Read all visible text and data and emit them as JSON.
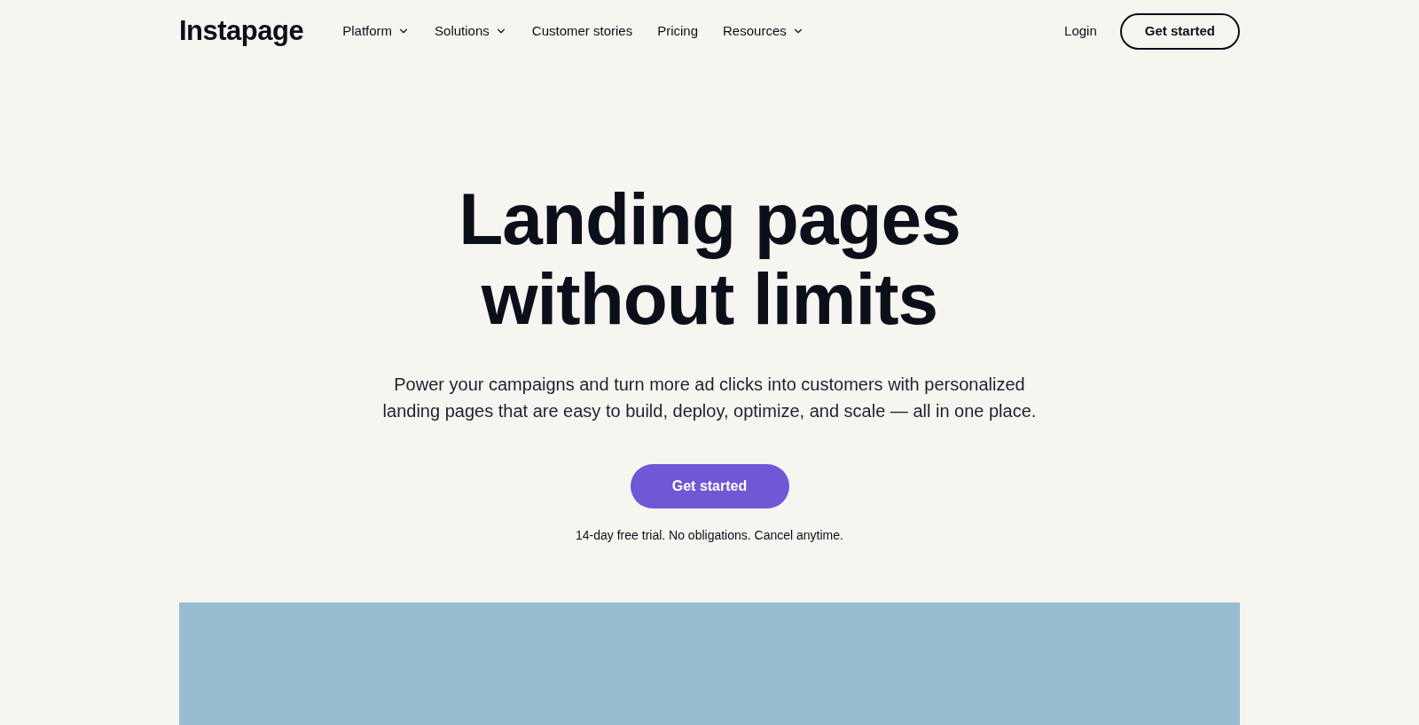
{
  "logo": "Instapage",
  "nav": [
    {
      "label": "Platform",
      "dropdown": true
    },
    {
      "label": "Solutions",
      "dropdown": true
    },
    {
      "label": "Customer stories",
      "dropdown": false
    },
    {
      "label": "Pricing",
      "dropdown": false
    },
    {
      "label": "Resources",
      "dropdown": true
    }
  ],
  "login": "Login",
  "header_cta": "Get started",
  "hero": {
    "title_lines": [
      "Landing pages",
      "without limits"
    ],
    "subtitle_lines": [
      "Power your campaigns and turn more ad clicks into customers with personalized",
      "landing pages that are easy to build, deploy, optimize, and scale — all in one place."
    ],
    "cta": "Get started",
    "note": "14-day free trial. No obligations. Cancel anytime."
  }
}
